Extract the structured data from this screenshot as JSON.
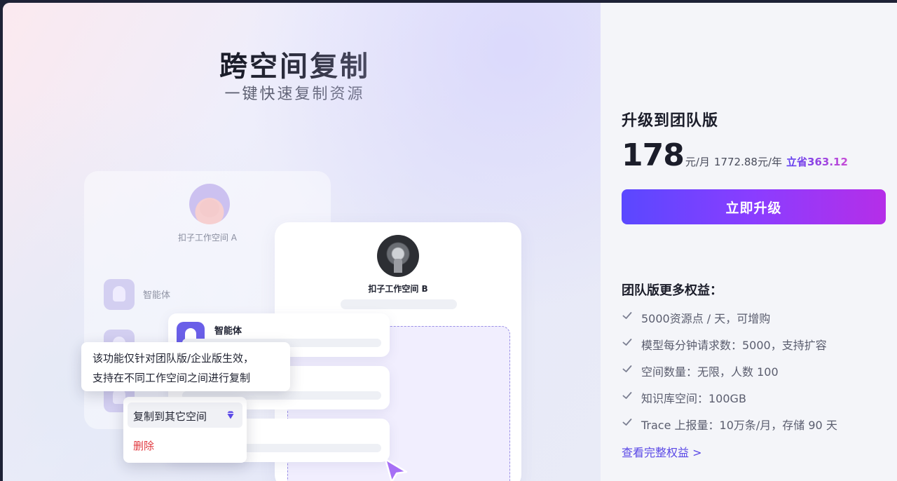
{
  "promo": {
    "title": "跨空间复制",
    "subtitle": "一键快速复制资源",
    "workspace_a": {
      "name": "扣子工作空间 A",
      "agent_label": "智能体"
    },
    "workspace_b": {
      "name": "扣子工作空间 B"
    },
    "stack_card_title": "智能体",
    "tooltip": {
      "line1": "该功能仅针对团队版/企业版生效，",
      "line2": "支持在不同工作空间之间进行复制"
    },
    "context_menu": {
      "copy_label": "复制到其它空间",
      "delete_label": "删除",
      "delete_color": "#e0383e"
    }
  },
  "upgrade": {
    "title": "升级到团队版",
    "price": "178",
    "price_unit": "元/月",
    "yearly": "1772.88元/年",
    "save": "立省363.12",
    "button_label": "立即升级",
    "benefits_title": "团队版更多权益：",
    "benefits": [
      "5000资源点 / 天，可增购",
      "模型每分钟请求数：5000，支持扩容",
      "空间数量：无限，人数 100",
      "知识库空间：100GB",
      "Trace 上报量：10万条/月，存储 90 天"
    ],
    "more_link": "查看完整权益 >",
    "accent": "#5a48ff"
  }
}
